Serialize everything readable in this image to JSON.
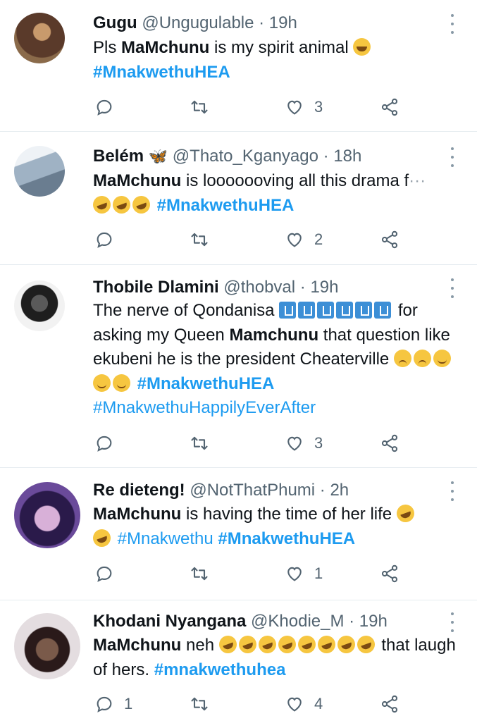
{
  "tweets": [
    {
      "name": "Gugu",
      "handle": "@Ungugulable",
      "time": "19h",
      "body_parts": {
        "a": "Pls ",
        "mention": "MaMchunu",
        "b": " is my spirit animal",
        "tag": "#MnakwethuHEA"
      },
      "reply_count": "",
      "retweet_count": "",
      "like_count": "3",
      "avatar_colors": [
        "#5a3a2a",
        "#c89a6c"
      ]
    },
    {
      "name": "Belém",
      "name_emoji": "butterfly",
      "handle": "@Thato_Kganyago",
      "time": "18h",
      "body_parts": {
        "mention": "MaMchunu",
        "b": " is looooooving all this drama f",
        "c": "···",
        "tag": "#MnakwethuHEA"
      },
      "reply_count": "",
      "retweet_count": "",
      "like_count": "2",
      "avatar_colors": [
        "#c7d4df",
        "#6a7d90"
      ]
    },
    {
      "name": "Thobile Dlamini",
      "handle": "@thobval",
      "time": "19h",
      "body_parts": {
        "a": "The nerve of Qondanisa ",
        "b": " for asking my Queen ",
        "mention": "Mamchunu",
        "c": " that question like ekubeni he is the president Cheaterville ",
        "tag": "#MnakwethuHEA",
        "tag2": "#MnakwethuHappilyEverAfter"
      },
      "reply_count": "",
      "retweet_count": "",
      "like_count": "3",
      "avatar_colors": [
        "#e9e9e9",
        "#2a2a2a"
      ]
    },
    {
      "name": "Re dieteng!",
      "handle": "@NotThatPhumi",
      "time": "2h",
      "body_parts": {
        "mention": "MaMchunu",
        "b": " is having the time of her life ",
        "tag_plain": "#Mnakwethu",
        "tag": "#MnakwethuHEA"
      },
      "reply_count": "",
      "retweet_count": "",
      "like_count": "1",
      "avatar_colors": [
        "#3a2a6a",
        "#d8b0d8"
      ]
    },
    {
      "name": "Khodani Nyangana",
      "handle": "@Khodie_M",
      "time": "19h",
      "body_parts": {
        "mention": "MaMchunu",
        "b": " neh ",
        "c": " that laugh of hers. ",
        "tag": "#mnakwethuhea"
      },
      "reply_count": "1",
      "retweet_count": "",
      "like_count": "4",
      "avatar_colors": [
        "#d8d0d4",
        "#3a2a2a"
      ]
    }
  ],
  "separator": " · ",
  "colors": {
    "accent": "#1d9bf0",
    "muted": "#536471",
    "text": "#0f1419",
    "divider": "#e6ecf0"
  }
}
